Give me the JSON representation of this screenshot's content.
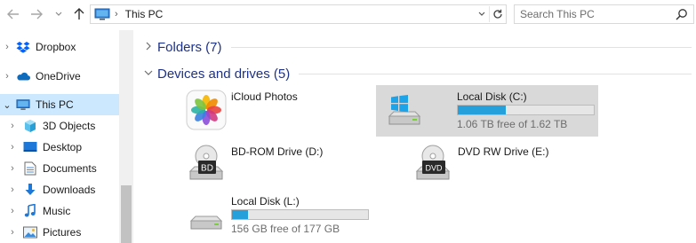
{
  "address": {
    "back_icon": "arrow-left-icon",
    "forward_icon": "arrow-right-icon",
    "recent_icon": "chevron-down-icon",
    "up_icon": "arrow-up-icon",
    "path_separator": "›",
    "path_text": "This PC",
    "search_placeholder": "Search This PC"
  },
  "nav": {
    "items": [
      {
        "label": "Dropbox",
        "icon": "dropbox-icon",
        "expand": "›"
      },
      {
        "label": "OneDrive",
        "icon": "onedrive-icon",
        "expand": "›"
      },
      {
        "label": "This PC",
        "icon": "this-pc-icon",
        "expand": "⌄",
        "selected": true
      },
      {
        "label": "3D Objects",
        "icon": "3d-objects-icon",
        "expand": "›"
      },
      {
        "label": "Desktop",
        "icon": "desktop-icon",
        "expand": "›"
      },
      {
        "label": "Documents",
        "icon": "documents-icon",
        "expand": "›"
      },
      {
        "label": "Downloads",
        "icon": "downloads-icon",
        "expand": "›"
      },
      {
        "label": "Music",
        "icon": "music-icon",
        "expand": "›"
      },
      {
        "label": "Pictures",
        "icon": "pictures-icon",
        "expand": "›"
      }
    ]
  },
  "content": {
    "folders_header": "Folders (7)",
    "devices_header": "Devices and drives (5)",
    "devices": [
      {
        "name": "iCloud Photos",
        "icon": "icloud-photos-icon"
      },
      {
        "name": "Local Disk (C:)",
        "icon": "windows-drive-icon",
        "free_text": "1.06 TB free of 1.62 TB",
        "used_fraction": 0.35,
        "selected": true
      },
      {
        "name": "BD-ROM Drive (D:)",
        "icon": "bd-drive-icon",
        "badge": "BD"
      },
      {
        "name": "DVD RW Drive (E:)",
        "icon": "dvd-drive-icon",
        "badge": "DVD"
      },
      {
        "name": "Local Disk (L:)",
        "icon": "hard-drive-icon",
        "free_text": "156 GB free of 177 GB",
        "used_fraction": 0.12
      }
    ]
  },
  "colors": {
    "selection": "#cce8ff",
    "group_header": "#1e3287",
    "capacity_bar": "#26a0da",
    "tile_selected": "#d9d9d9"
  }
}
